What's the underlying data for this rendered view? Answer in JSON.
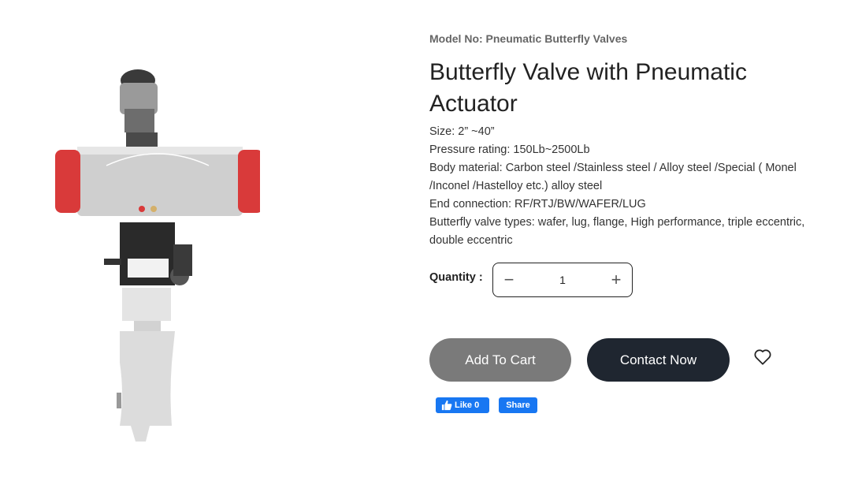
{
  "product": {
    "model_no": "Model No: Pneumatic Butterfly Valves",
    "title": "Butterfly Valve with Pneumatic Actuator",
    "specs": [
      "Size: 2”  ~40”",
      "Pressure rating: 150Lb~2500Lb",
      "Body material: Carbon steel /Stainless steel / Alloy steel /Special ( Monel /Inconel /Hastelloy etc.) alloy steel",
      "End connection: RF/RTJ/BW/WAFER/LUG",
      "Butterfly valve types: wafer, lug, flange, High performance, triple eccentric, double eccentric"
    ]
  },
  "quantity": {
    "label": "Quantity :",
    "minus": "−",
    "value": "1",
    "plus": "+"
  },
  "buttons": {
    "add_to_cart": "Add To Cart",
    "contact_now": "Contact Now"
  },
  "social": {
    "like": "Like 0",
    "share": "Share"
  },
  "icons": {
    "wishlist": "heart-outline-icon",
    "like": "thumbs-up-icon"
  },
  "colors": {
    "cart_bg": "#7a7a7a",
    "contact_bg": "#1f2630",
    "facebook": "#1877f2",
    "actuator_red": "#d93a3a"
  }
}
